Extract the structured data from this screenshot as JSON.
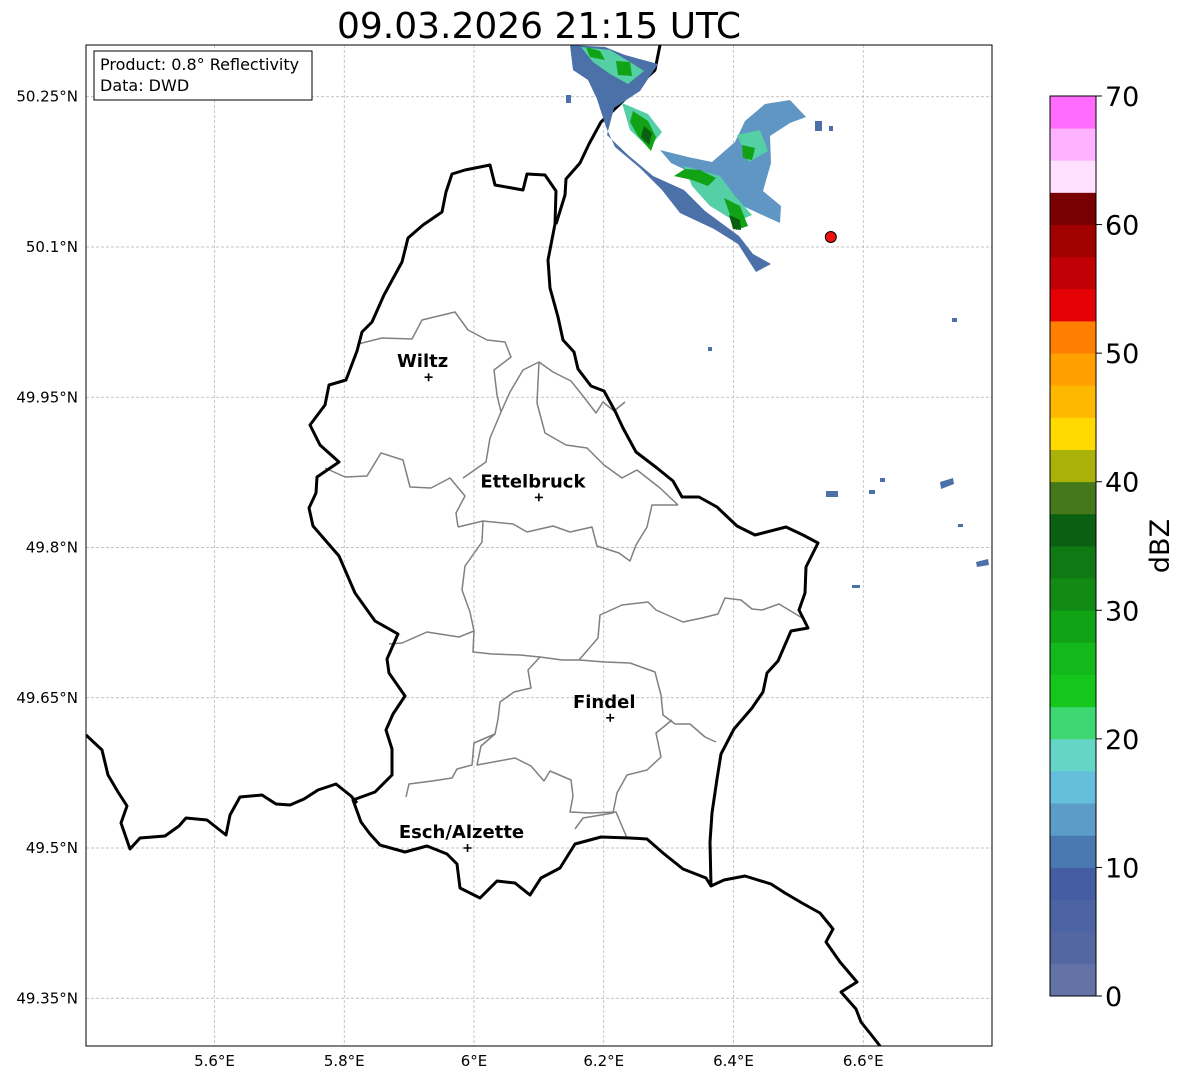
{
  "title": "09.03.2026 21:15 UTC",
  "info": {
    "product": "Product: 0.8° Reflectivity",
    "data_source": "Data: DWD"
  },
  "map": {
    "lon_ticks": [
      "5.6°E",
      "5.8°E",
      "6°E",
      "6.2°E",
      "6.4°E",
      "6.6°E"
    ],
    "lat_ticks": [
      "50.25°N",
      "50.1°N",
      "49.95°N",
      "49.8°N",
      "49.65°N",
      "49.5°N",
      "49.35°N"
    ],
    "grid": true,
    "cities": [
      {
        "name": "Wiltz",
        "lon": 5.93,
        "lat": 49.97
      },
      {
        "name": "Ettelbruck",
        "lon": 6.1,
        "lat": 49.85
      },
      {
        "name": "Findel",
        "lon": 6.21,
        "lat": 49.63
      },
      {
        "name": "Esch/Alzette",
        "lon": 5.99,
        "lat": 49.5
      }
    ],
    "marker": {
      "lon": 6.55,
      "lat": 50.11,
      "color": "#ee1111"
    }
  },
  "colorbar": {
    "label": "dBZ",
    "ticks": [
      "0",
      "10",
      "20",
      "30",
      "40",
      "50",
      "60",
      "70"
    ],
    "min": 0,
    "max": 70,
    "step": 2.5,
    "colors": [
      "#6373a6",
      "#5467a0",
      "#4c64a1",
      "#455ea3",
      "#4a79b1",
      "#5b9dc8",
      "#66bedd",
      "#64d5c6",
      "#3ed873",
      "#15c71a",
      "#13b91b",
      "#11a215",
      "#118b13",
      "#0f7914",
      "#0a6010",
      "#44781b",
      "#aab20a",
      "#ffd900",
      "#ffb800",
      "#ff9f00",
      "#ff7f00",
      "#e50005",
      "#c00004",
      "#a00000",
      "#780000",
      "#ffe0ff",
      "#ffb2ff",
      "#ff6bff",
      "#ee33ee"
    ]
  }
}
